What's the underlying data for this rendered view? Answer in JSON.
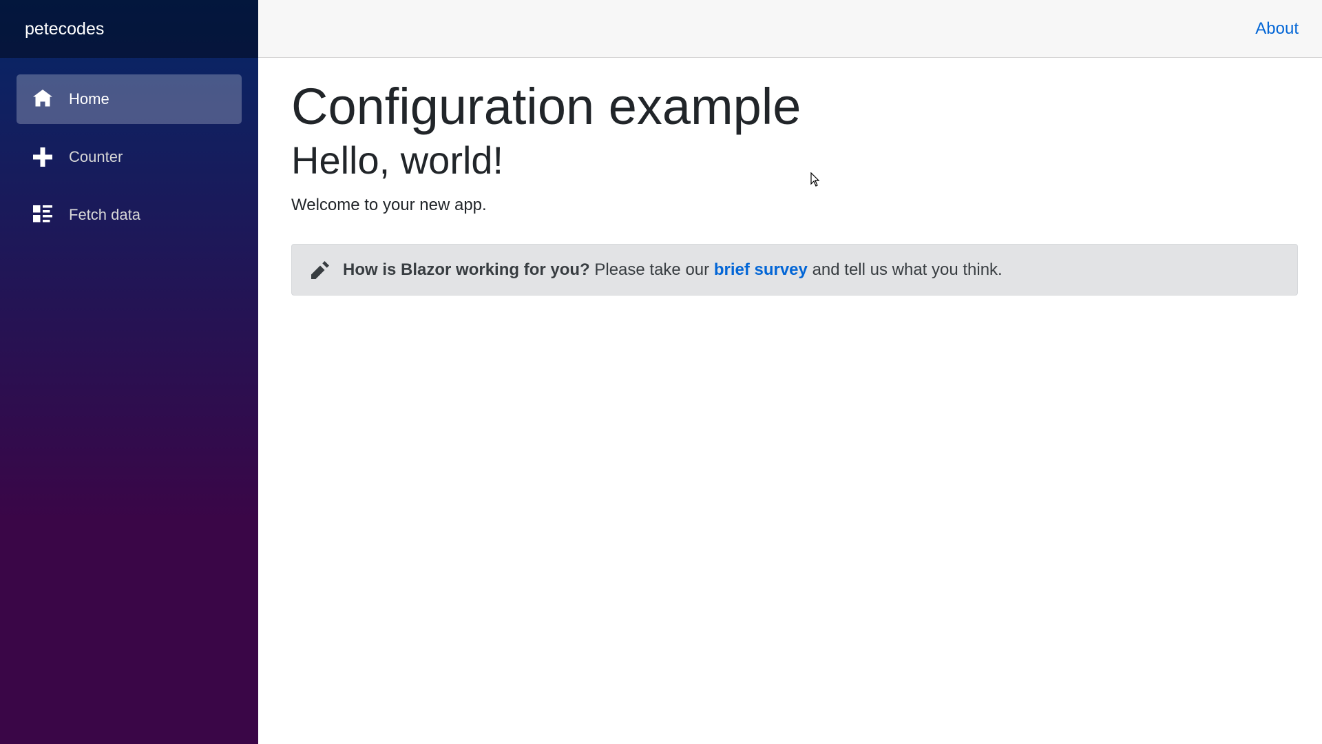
{
  "sidebar": {
    "brand": "petecodes",
    "items": [
      {
        "label": "Home",
        "icon": "home-icon",
        "active": true
      },
      {
        "label": "Counter",
        "icon": "plus-icon",
        "active": false
      },
      {
        "label": "Fetch data",
        "icon": "list-rich-icon",
        "active": false
      }
    ]
  },
  "top_row": {
    "about_link": "About"
  },
  "content": {
    "page_title": "Configuration example",
    "heading": "Hello, world!",
    "welcome": "Welcome to your new app.",
    "survey": {
      "icon": "pencil-icon",
      "question": "How is Blazor working for you?",
      "text_before_link": "Please take our",
      "link_text": "brief survey",
      "text_after_link": "and tell us what you think."
    }
  },
  "colors": {
    "sidebar_gradient_top": "#052767",
    "sidebar_gradient_bottom": "#3a0647",
    "link": "#0366d6",
    "alert_bg": "#e2e3e5",
    "top_row_bg": "#f7f7f7"
  }
}
